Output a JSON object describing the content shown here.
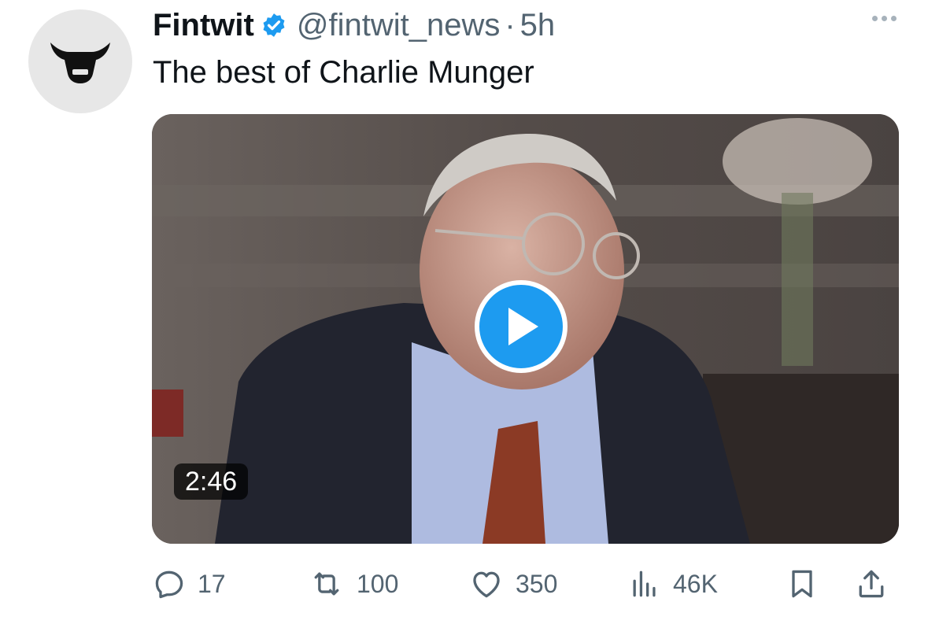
{
  "tweet": {
    "author_name": "Fintwit",
    "handle": "@fintwit_news",
    "separator": "·",
    "time": "5h",
    "text": "The best of Charlie Munger"
  },
  "media": {
    "duration": "2:46"
  },
  "actions": {
    "replies": "17",
    "reposts": "100",
    "likes": "350",
    "views": "46K"
  },
  "colors": {
    "accent": "#1d9bf0",
    "secondary_text": "#536471",
    "primary_text": "#0f1419"
  }
}
